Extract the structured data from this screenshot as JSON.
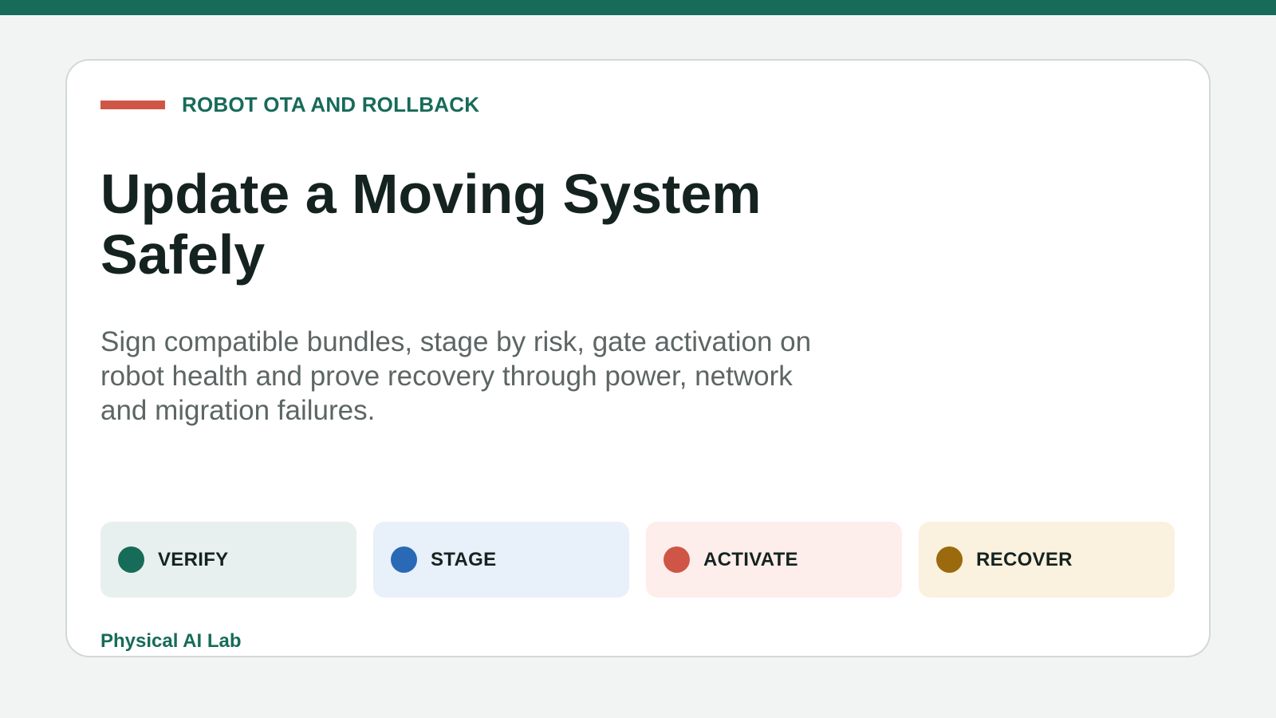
{
  "eyebrow": {
    "text": "ROBOT OTA AND ROLLBACK"
  },
  "title": "Update a Moving System Safely",
  "subtitle": "Sign compatible bundles, stage by risk, gate activation on robot health and prove recovery through power, network and migration failures.",
  "stages": [
    {
      "label": "VERIFY",
      "dot_color": "#176b59",
      "bg_color": "#e7f0ee"
    },
    {
      "label": "STAGE",
      "dot_color": "#2a69b5",
      "bg_color": "#e8f0f9"
    },
    {
      "label": "ACTIVATE",
      "dot_color": "#cf5646",
      "bg_color": "#fdeeeb"
    },
    {
      "label": "RECOVER",
      "dot_color": "#9a6a0c",
      "bg_color": "#faf1de"
    }
  ],
  "footer": {
    "text": "Physical AI Lab"
  },
  "colors": {
    "brand": "#176b59",
    "accent": "#cf5646",
    "title_text": "#152320",
    "body_text": "#5c6664",
    "page_bg": "#f2f4f3",
    "card_bg": "#ffffff"
  }
}
